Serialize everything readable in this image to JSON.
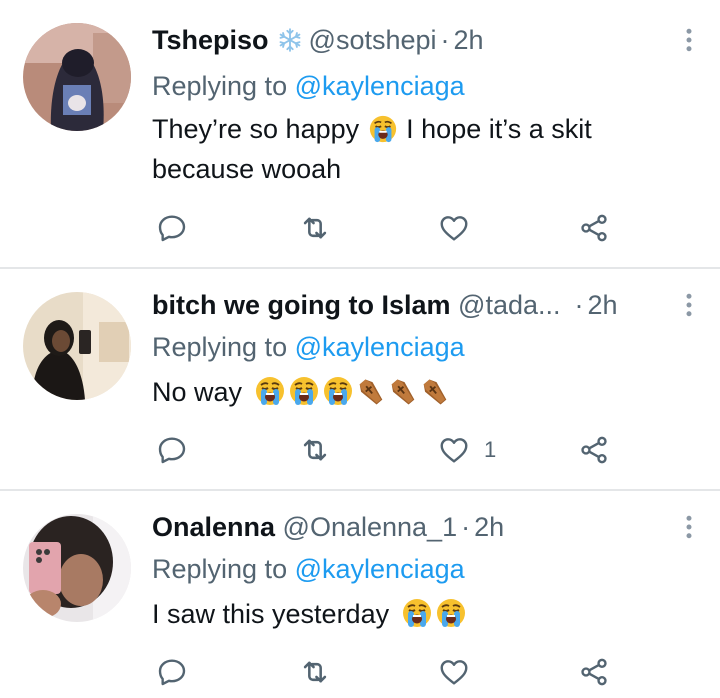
{
  "tweets": [
    {
      "name": "Tshepiso",
      "has_snowflake": true,
      "handle": "@sotshepi",
      "time": "2h",
      "replying_prefix": "Replying to",
      "replying_mention": "@kaylenciaga",
      "text_1": "They’re so happy",
      "text_2": "I hope it’s a skit because wooah",
      "emoji": [
        "loudly-crying-face"
      ],
      "likes": ""
    },
    {
      "name": "bitch we going to Islam",
      "handle": "@tada...",
      "time": "2h",
      "replying_prefix": "Replying to",
      "replying_mention": "@kaylenciaga",
      "text_1": "No way",
      "emoji": [
        "loudly-crying-face",
        "loudly-crying-face",
        "loudly-crying-face",
        "coffin",
        "coffin",
        "coffin"
      ],
      "likes": "1"
    },
    {
      "name": "Onalenna",
      "handle": "@Onalenna_1",
      "time": "2h",
      "replying_prefix": "Replying to",
      "replying_mention": "@kaylenciaga",
      "text_1": "I saw this yesterday",
      "emoji": [
        "loudly-crying-face",
        "loudly-crying-face"
      ],
      "likes": ""
    }
  ],
  "icons": {
    "reply": "reply-icon",
    "retweet": "retweet-icon",
    "like": "heart-icon",
    "share": "share-icon",
    "more": "more-vertical-icon"
  },
  "colors": {
    "name": "#0f1419",
    "secondary": "#536471",
    "mention": "#1d9bf0",
    "divider": "#e4e6e8"
  }
}
